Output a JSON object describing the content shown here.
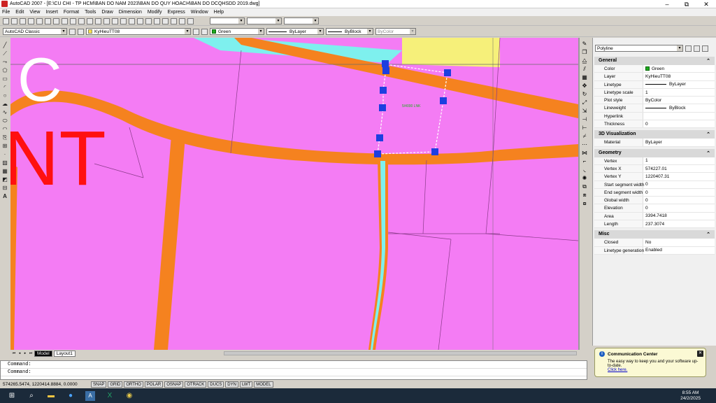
{
  "window": {
    "title": "AutoCAD 2007 - [E:\\CU CHI - TP HCM\\BAN DO NAM 2023\\BAN DO QUY HOACH\\BAN DO DCQHSDD 2019.dwg]",
    "minimize": "–",
    "restore": "⧉",
    "close": "✕"
  },
  "menu": [
    "File",
    "Edit",
    "View",
    "Insert",
    "Format",
    "Tools",
    "Draw",
    "Dimension",
    "Modify",
    "Express",
    "Window",
    "Help"
  ],
  "toolbar2": {
    "workspace": "AutoCAD Classic",
    "layer": "KyHieuTT08",
    "color": "Green",
    "linetype": "ByLayer",
    "lineweight": "ByBlock",
    "plotstyle": "ByColor"
  },
  "drawing": {
    "big_letters_1": "C",
    "big_letters_2": "NT",
    "object_label": "5/4000 LNK"
  },
  "properties": {
    "object_type": "Polyline",
    "sections": [
      {
        "title": "General",
        "rows": [
          {
            "k": "Color",
            "v": "Green",
            "swatch": true
          },
          {
            "k": "Layer",
            "v": "KyHieuTT08"
          },
          {
            "k": "Linetype",
            "v": "ByLayer",
            "line": true
          },
          {
            "k": "Linetype scale",
            "v": "1"
          },
          {
            "k": "Plot style",
            "v": "ByColor"
          },
          {
            "k": "Lineweight",
            "v": "ByBlock",
            "line": true
          },
          {
            "k": "Hyperlink",
            "v": ""
          },
          {
            "k": "Thickness",
            "v": "0"
          }
        ]
      },
      {
        "title": "3D Visualization",
        "rows": [
          {
            "k": "Material",
            "v": "ByLayer"
          }
        ]
      },
      {
        "title": "Geometry",
        "rows": [
          {
            "k": "Vertex",
            "v": "1"
          },
          {
            "k": "Vertex X",
            "v": "574227.01"
          },
          {
            "k": "Vertex Y",
            "v": "1220407.31"
          },
          {
            "k": "Start segment width",
            "v": "0"
          },
          {
            "k": "End segment width",
            "v": "0"
          },
          {
            "k": "Global width",
            "v": "0"
          },
          {
            "k": "Elevation",
            "v": "0"
          },
          {
            "k": "Area",
            "v": "3394.7418"
          },
          {
            "k": "Length",
            "v": "237.3074"
          }
        ]
      },
      {
        "title": "Misc",
        "rows": [
          {
            "k": "Closed",
            "v": "No"
          },
          {
            "k": "Linetype generation",
            "v": "Enabled"
          }
        ]
      }
    ]
  },
  "tabs": [
    "Model",
    "Layout1"
  ],
  "command_lines": [
    "Command:",
    "Command:"
  ],
  "status": {
    "coords": "574265.5474, 1220414.8884, 0.0000",
    "toggles": [
      "SNAP",
      "GRID",
      "ORTHO",
      "POLAR",
      "OSNAP",
      "OTRACK",
      "DUCS",
      "DYN",
      "LWT",
      "MODEL"
    ]
  },
  "notification": {
    "title": "Communication Center",
    "body": "The easy way to keep you and your software up-to-date.",
    "link": "Click here."
  },
  "taskbar": {
    "time": "8:55 AM",
    "date": "24/2/2025"
  },
  "colors": {
    "parcel": "#f47cf4",
    "road": "#f5821f",
    "river": "#7ef0ee",
    "yellow_zone": "#f6f07a",
    "red_text": "#ff1010",
    "grips": "#1d3fe0"
  }
}
